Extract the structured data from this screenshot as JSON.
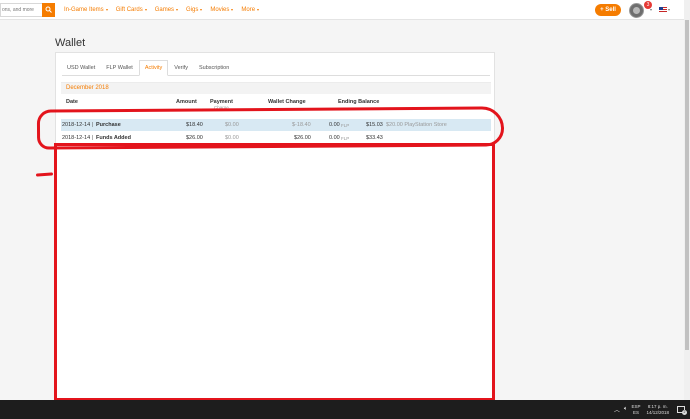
{
  "nav": {
    "search_placeholder": "ons, and more",
    "menu": [
      "In-Game Items",
      "Gift Cards",
      "Games",
      "Gigs",
      "Movies",
      "More"
    ],
    "sell_label": "+ Sell",
    "notification_count": "3"
  },
  "page_title": "Wallet",
  "tabs": [
    "USD Wallet",
    "FLP Wallet",
    "Activity",
    "Verify",
    "Subscription"
  ],
  "active_tab": "Activity",
  "month": "December 2018",
  "columns": {
    "date": "Date",
    "amount": "Amount",
    "payment": "Payment",
    "charge": "Charge",
    "wallet_change": "Wallet Change",
    "ending_balance": "Ending Balance"
  },
  "rows": [
    {
      "date": "2018-12-14",
      "sep": "|",
      "type": "Purchase",
      "amount": "$18.40",
      "payment": "$0.00",
      "wallet_change": "$-18.40",
      "flp": "0.00",
      "flp_unit": "FLP",
      "balance": "$15.03",
      "note": "$20.00 PlayStation Store"
    },
    {
      "date": "2018-12-14",
      "sep": "|",
      "type": "Funds Added",
      "amount": "$26.00",
      "payment": "$0.00",
      "wallet_change": "$26.00",
      "flp": "0.00",
      "flp_unit": "FLP",
      "balance": "$33.43",
      "note": ""
    }
  ],
  "taskbar": {
    "lang_line1": "ESP",
    "lang_line2": "ES",
    "time": "8:17 p. m.",
    "date": "14/12/2018",
    "notify_count": "2"
  },
  "colors": {
    "accent": "#f57c00",
    "annotation": "#e3141c",
    "row_highlight": "#d8e9f3",
    "taskbar": "#1d1d1d"
  }
}
